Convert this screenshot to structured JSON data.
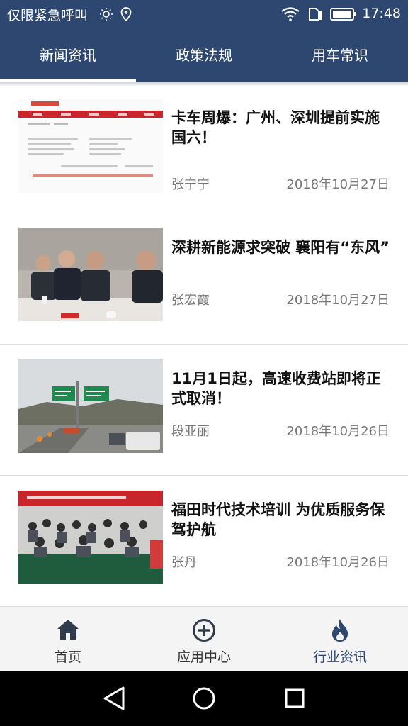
{
  "status_bar": {
    "carrier": "仅限紧急呼叫",
    "time": "17:48",
    "icons": [
      "brightness-icon",
      "location-icon",
      "wifi-icon",
      "sim-icon",
      "battery-icon"
    ]
  },
  "top_tabs": [
    {
      "label": "新闻资讯",
      "active": true
    },
    {
      "label": "政策法规",
      "active": false
    },
    {
      "label": "用车常识",
      "active": false
    }
  ],
  "news": [
    {
      "title": "卡车周爆：广州、深圳提前实施国六！",
      "author": "张宁宁",
      "date": "2018年10月27日"
    },
    {
      "title": "深耕新能源求突破 襄阳有“东风”",
      "author": "张宏霞",
      "date": "2018年10月27日"
    },
    {
      "title": "11月1日起，高速收费站即将正式取消！",
      "author": "段亚丽",
      "date": "2018年10月26日"
    },
    {
      "title": "福田时代技术培训 为优质服务保驾护航",
      "author": "张丹",
      "date": "2018年10月26日"
    }
  ],
  "bottom_nav": [
    {
      "label": "首页",
      "icon": "home-icon"
    },
    {
      "label": "应用中心",
      "icon": "plus-circle-icon"
    },
    {
      "label": "行业资讯",
      "icon": "flame-icon",
      "active": true
    }
  ],
  "system_nav": [
    "back-icon",
    "home-circle-icon",
    "recents-icon"
  ],
  "colors": {
    "primary": "#2e4770",
    "text": "#111111",
    "muted": "#777777"
  }
}
